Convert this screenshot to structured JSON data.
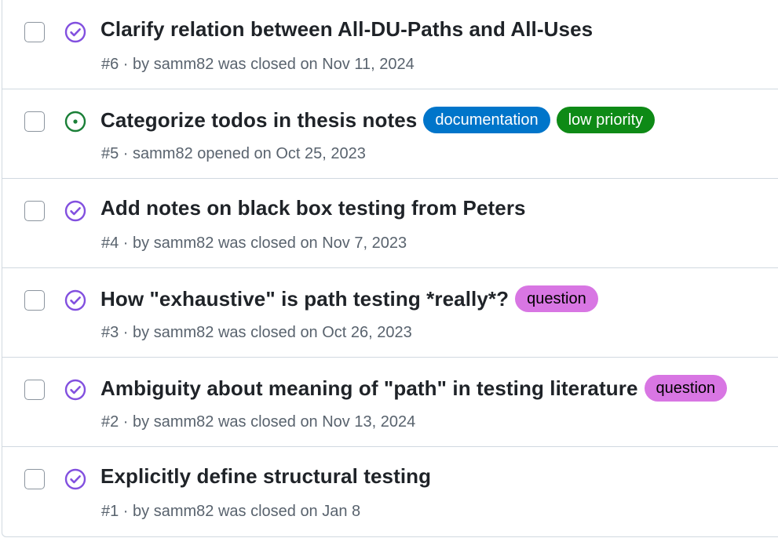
{
  "colors": {
    "closed_icon": "#8250df",
    "open_icon": "#1a7f37",
    "meta_text": "#59636e",
    "title_text": "#1f2328",
    "border": "#d1d9e0"
  },
  "issues": [
    {
      "title": "Clarify relation between All-DU-Paths and All-Uses",
      "meta": "#6 · by samm82 was closed on Nov 11, 2024",
      "state": "closed",
      "state_icon": "issue-closed-icon",
      "labels": []
    },
    {
      "title": "Categorize todos in thesis notes",
      "meta": "#5 · samm82 opened on Oct 25, 2023",
      "state": "open",
      "state_icon": "issue-opened-icon",
      "labels": [
        {
          "text": "documentation",
          "bg": "#0075ca",
          "fg": "#ffffff"
        },
        {
          "text": "low priority",
          "bg": "#0e8a16",
          "fg": "#ffffff"
        }
      ]
    },
    {
      "title": "Add notes on black box testing from Peters",
      "meta": "#4 · by samm82 was closed on Nov 7, 2023",
      "state": "closed",
      "state_icon": "issue-closed-icon",
      "labels": []
    },
    {
      "title": "How \"exhaustive\" is path testing *really*?",
      "meta": "#3 · by samm82 was closed on Oct 26, 2023",
      "state": "closed",
      "state_icon": "issue-closed-icon",
      "labels": [
        {
          "text": "question",
          "bg": "#d876e3",
          "fg": "#000000"
        }
      ]
    },
    {
      "title": "Ambiguity about meaning of \"path\" in testing literature",
      "meta": "#2 · by samm82 was closed on Nov 13, 2024",
      "state": "closed",
      "state_icon": "issue-closed-icon",
      "labels": [
        {
          "text": "question",
          "bg": "#d876e3",
          "fg": "#000000"
        }
      ]
    },
    {
      "title": "Explicitly define structural testing",
      "meta": "#1 · by samm82 was closed on Jan 8",
      "state": "closed",
      "state_icon": "issue-closed-icon",
      "labels": []
    }
  ]
}
